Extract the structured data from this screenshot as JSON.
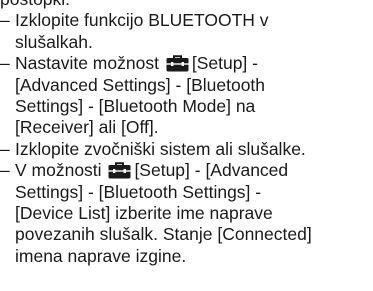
{
  "document": {
    "line0": "postopki:",
    "bullet": "–",
    "items": [
      {
        "lines": [
          "Izklopite funkcijo BLUETOOTH v",
          "slušalkah."
        ]
      },
      {
        "l1_before": "Nastavite možnost",
        "l1_after": "[Setup] -",
        "lines": [
          "[Advanced Settings] - [Bluetooth",
          "Settings] - [Bluetooth Mode] na",
          "[Receiver] ali [Off]."
        ]
      },
      {
        "lines": [
          "Izklopite zvočniški sistem ali slušalke."
        ]
      },
      {
        "l1_before": "V možnosti",
        "l1_after": "[Setup] - [Advanced",
        "lines": [
          "Settings] - [Bluetooth Settings] -",
          "[Device List] izberite ime naprave",
          "povezanih slušalk. Stanje [Connected]",
          "imena naprave izgine."
        ]
      }
    ],
    "icon": "toolbox-icon"
  }
}
